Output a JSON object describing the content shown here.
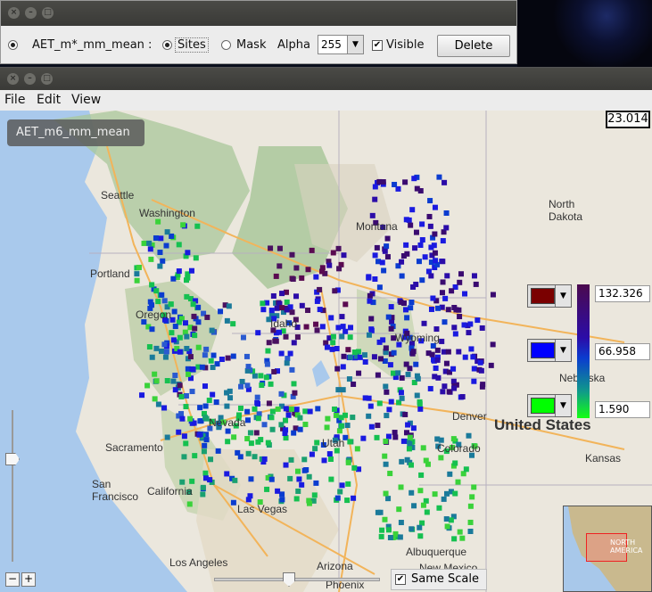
{
  "top_window": {
    "layer_label": "AET_m*_mm_mean :",
    "option_sites": "Sites",
    "option_mask": "Mask",
    "alpha_label": "Alpha",
    "alpha_value": "255",
    "visible_label": "Visible",
    "delete_label": "Delete"
  },
  "menu": {
    "file": "File",
    "edit": "Edit",
    "view": "View"
  },
  "map": {
    "layer_name": "AET_m6_mm_mean",
    "scale_value": "23.014",
    "legend": {
      "max": "132.326",
      "mid": "66.958",
      "min": "1.590",
      "max_color": "#7a0000",
      "mid_color": "#0000ff",
      "min_color": "#00ff00"
    },
    "same_scale_label": "Same Scale",
    "inset_label": "NORTH AMERICA",
    "places": {
      "seattle": "Seattle",
      "washington": "Washington",
      "portland": "Portland",
      "oregon": "Oregon",
      "montana": "Montana",
      "idaho": "Idaho",
      "wyoming": "Wyoming",
      "nevada": "Nevada",
      "utah": "Utah",
      "colorado": "Colorado",
      "denver": "Denver",
      "sacramento": "Sacramento",
      "san_francisco": "San\nFrancisco",
      "california": "California",
      "las_vegas": "Las Vegas",
      "los_angeles": "Los Angeles",
      "arizona": "Arizona",
      "albuquerque": "Albuquerque",
      "new_mexico": "New Mexico",
      "phoenix": "Phoenix",
      "kansas": "Kansas",
      "nebraska": "Nebraska",
      "north_dakota": "North\nDakota",
      "united_states": "United States"
    }
  }
}
